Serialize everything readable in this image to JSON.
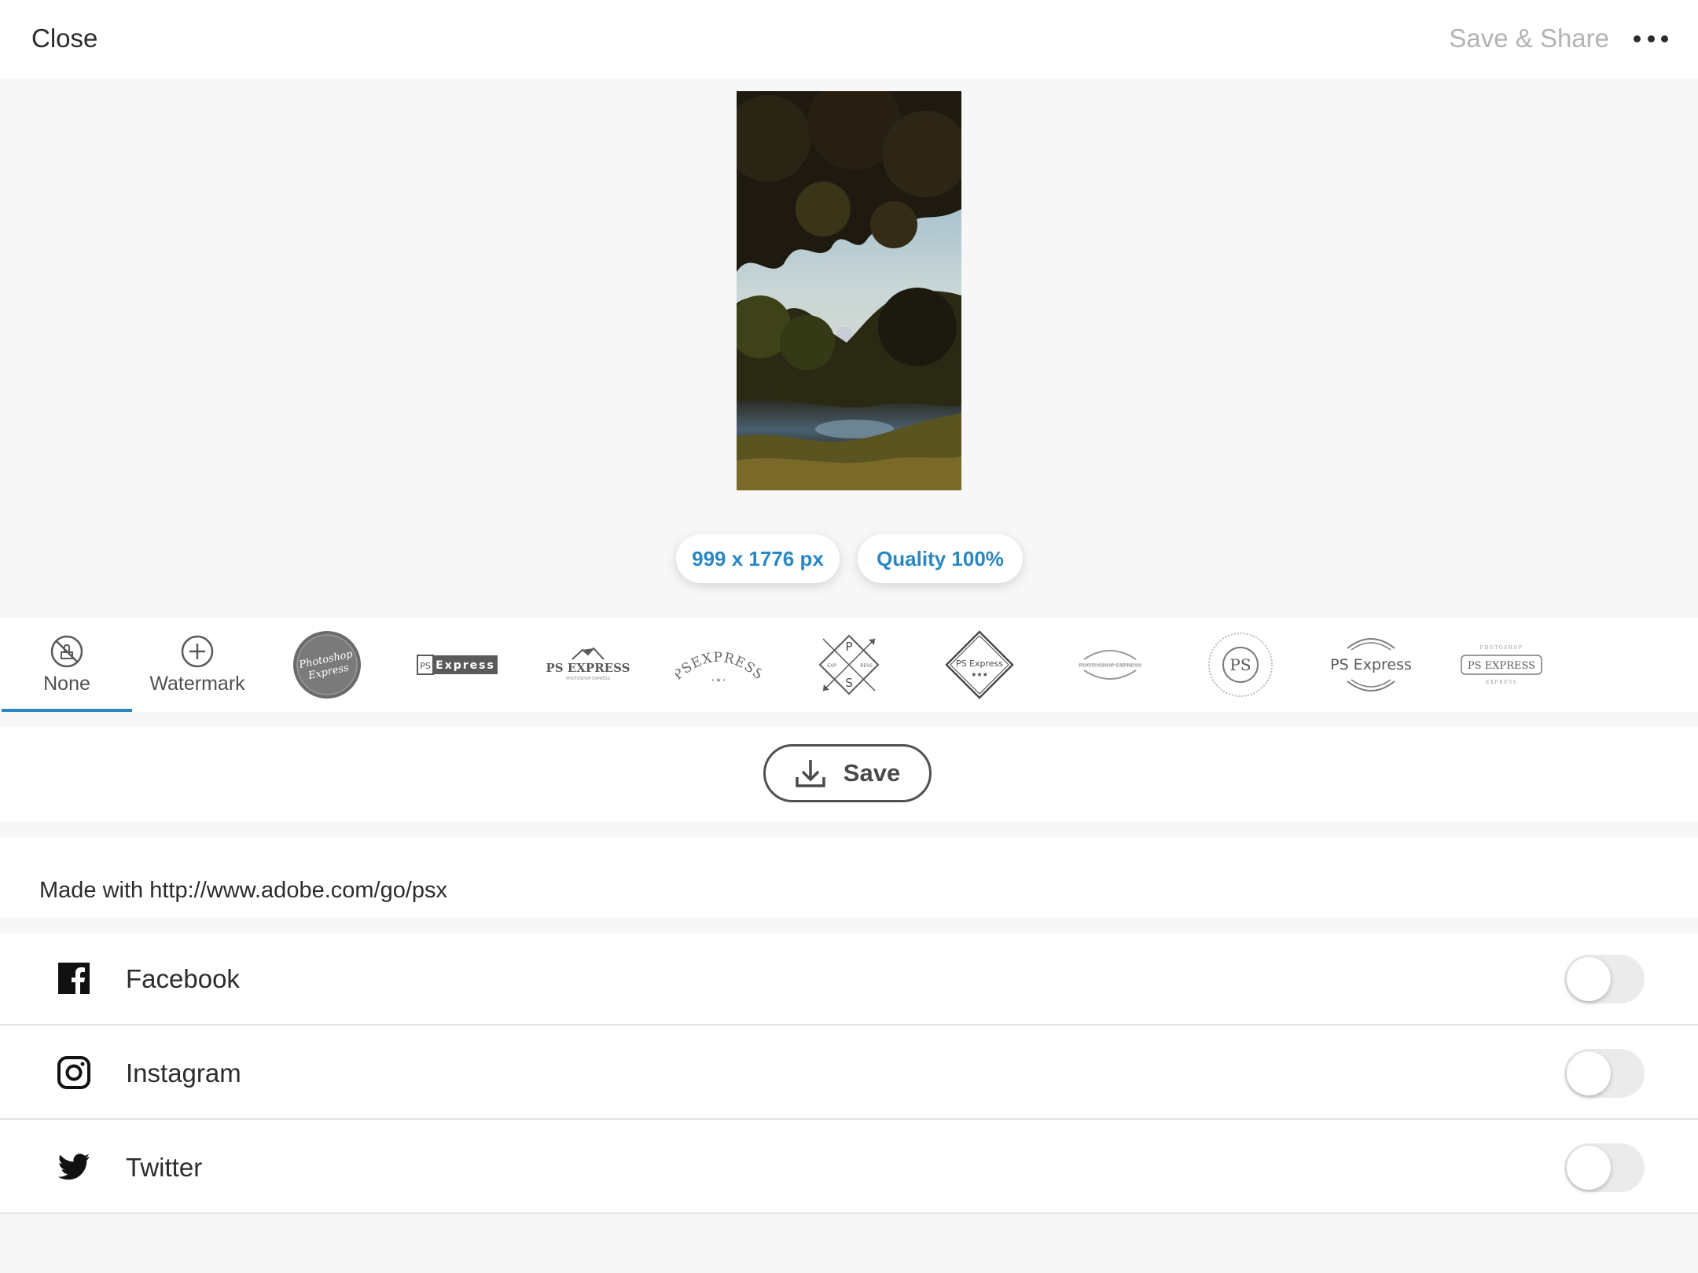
{
  "header": {
    "close_label": "Close",
    "save_share_label": "Save & Share",
    "more_icon": "more-horizontal-icon"
  },
  "preview": {
    "size_label": "999 x 1776 px",
    "quality_label": "Quality 100%"
  },
  "watermarks": {
    "none_label": "None",
    "watermark_label": "Watermark",
    "selected": "None",
    "styles": [
      {
        "name": "photoshop-express-seal",
        "lines": [
          "Photoshop",
          "Express"
        ]
      },
      {
        "name": "ps-express-bar",
        "lines": [
          "PS",
          "Express"
        ]
      },
      {
        "name": "ps-express-mountains",
        "lines": [
          "PS EXPRESS",
          "PHOTOSHOP EXPRESS"
        ]
      },
      {
        "name": "psexpress-arc",
        "lines": [
          "PSEXPRESS"
        ]
      },
      {
        "name": "ps-arrows-cross",
        "lines": [
          "P",
          "S",
          "EXP",
          "RESS"
        ]
      },
      {
        "name": "ps-express-diamond",
        "lines": [
          "PS Express",
          "★★★"
        ]
      },
      {
        "name": "photoshop-express-round",
        "lines": [
          "PHOTOSHOP EXPRESS"
        ]
      },
      {
        "name": "ps-circle-badge",
        "lines": [
          "PS"
        ]
      },
      {
        "name": "ps-express-rings",
        "lines": [
          "PS Express"
        ]
      },
      {
        "name": "ps-express-framed",
        "lines": [
          "PHOTOSHOP",
          "PS EXPRESS",
          "EXPRESS"
        ]
      }
    ]
  },
  "save": {
    "label": "Save",
    "icon": "download-icon"
  },
  "caption": {
    "text": "Made with http://www.adobe.com/go/psx"
  },
  "social": [
    {
      "label": "Facebook",
      "icon": "facebook-icon",
      "enabled": false
    },
    {
      "label": "Instagram",
      "icon": "instagram-icon",
      "enabled": false
    },
    {
      "label": "Twitter",
      "icon": "twitter-icon",
      "enabled": false
    }
  ],
  "colors": {
    "accent": "#2a87c2",
    "background": "#f7f7f7",
    "panel": "#ffffff",
    "text": "#2c2c2c",
    "muted": "#b3b3b3",
    "toggle_off": "#ebebeb"
  }
}
